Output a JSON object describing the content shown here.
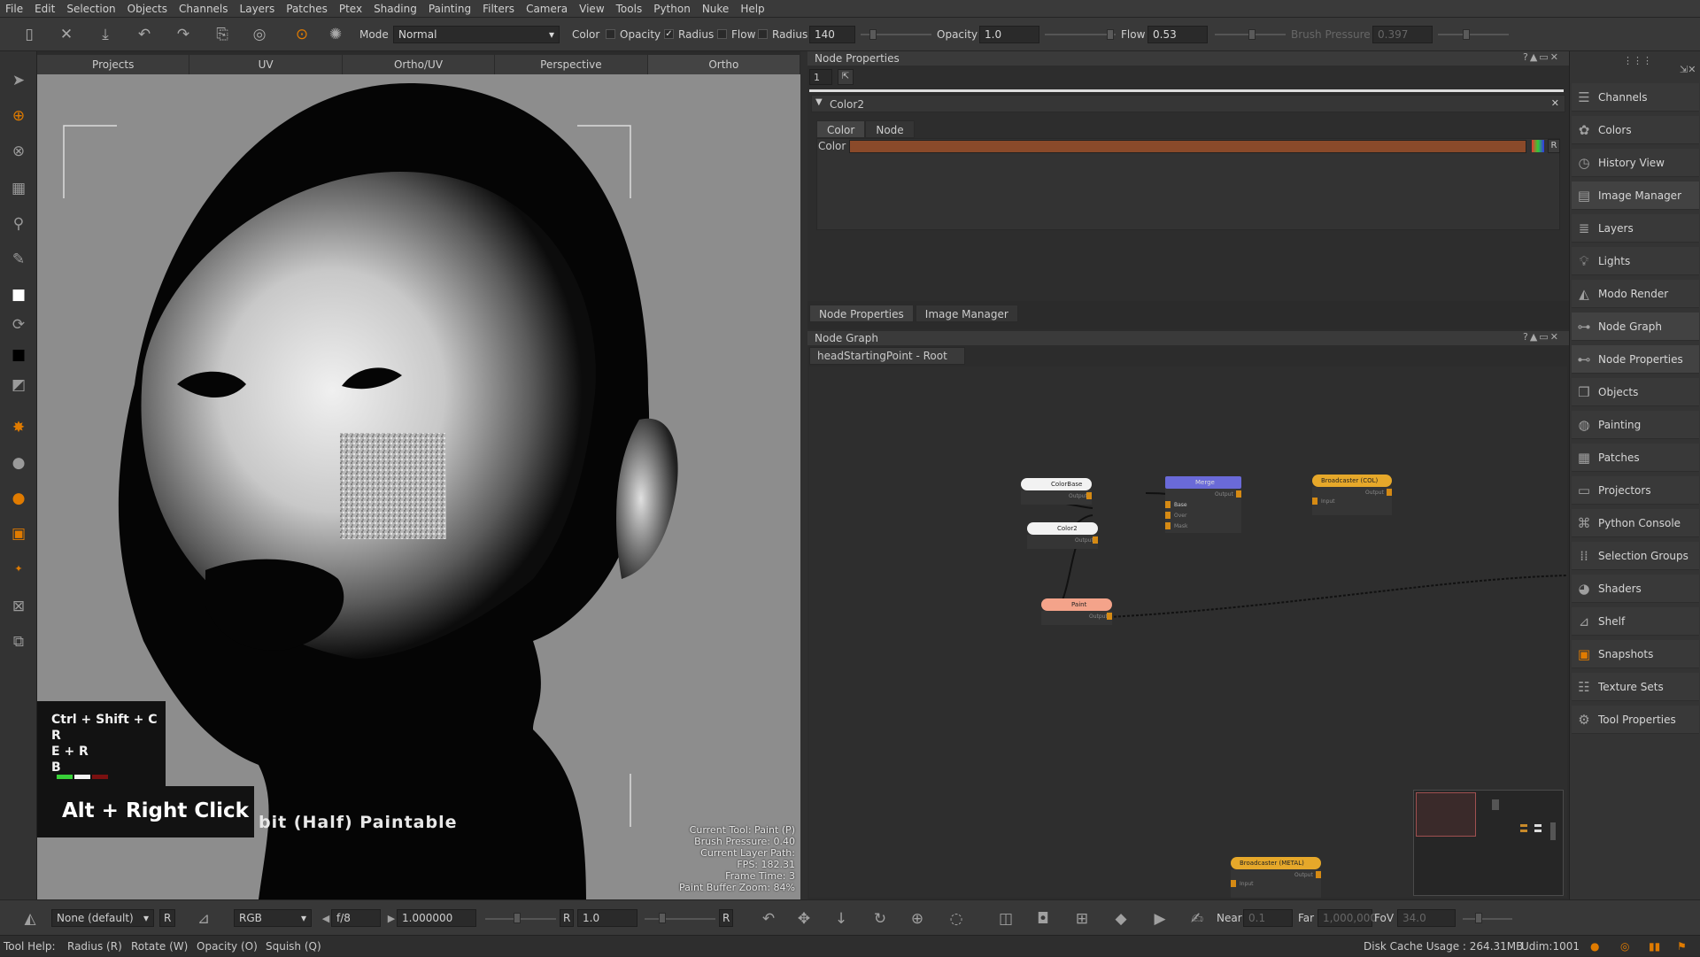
{
  "menu": [
    "File",
    "Edit",
    "Selection",
    "Objects",
    "Channels",
    "Layers",
    "Patches",
    "Ptex",
    "Shading",
    "Painting",
    "Filters",
    "Camera",
    "View",
    "Tools",
    "Python",
    "Nuke",
    "Help"
  ],
  "toolbar": {
    "mode_label": "Mode",
    "mode_value": "Normal",
    "color_label": "Color",
    "opacity_check_label": "Opacity",
    "radius_check_label": "Radius",
    "flow_check_label": "Flow",
    "radius_label": "Radius",
    "radius_value": "140",
    "opacity_label": "Opacity",
    "opacity_value": "1.0",
    "flow_label": "Flow",
    "flow_value": "0.53",
    "brush_pressure_label": "Brush Pressure",
    "brush_pressure_value": "0.397"
  },
  "view_tabs": [
    "Projects",
    "UV",
    "Ortho/UV",
    "Perspective",
    "Ortho"
  ],
  "viewport": {
    "hotkeys": [
      "Ctrl + Shift + C",
      "R",
      "E + R",
      "B"
    ],
    "alt_click": "Alt + Right Click",
    "paint_text": "bit (Half) Paintable",
    "info": [
      "Current Tool: Paint (P)",
      "Brush Pressure: 0.40",
      "Current Layer Path:",
      "FPS: 182.31",
      "Frame Time: 3",
      "Paint Buffer Zoom: 84%"
    ]
  },
  "node_properties": {
    "title": "Node Properties",
    "count": "1",
    "node_name": "Color2",
    "tabs": [
      "Color",
      "Node"
    ],
    "color_label": "Color",
    "color_value": "#8a4a2a",
    "reset_label": "R"
  },
  "bottom_tabs": [
    "Node Properties",
    "Image Manager"
  ],
  "node_graph": {
    "title": "Node Graph",
    "path_tab": "headStartingPoint - Root",
    "nodes": {
      "colorbase": "ColorBase",
      "color2": "Color2",
      "paint": "Paint",
      "merge": "Merge",
      "bcast_col": "Broadcaster (COL)",
      "bcast_metal": "Broadcaster (METAL)"
    },
    "ports": {
      "output": "Output",
      "input": "Input",
      "base": "Base",
      "over": "Over",
      "mask": "Mask"
    }
  },
  "dock": [
    "Channels",
    "Colors",
    "History View",
    "Image Manager",
    "Layers",
    "Lights",
    "Modo Render",
    "Node Graph",
    "Node Properties",
    "Objects",
    "Painting",
    "Patches",
    "Projectors",
    "Python Console",
    "Selection Groups",
    "Shaders",
    "Shelf",
    "Snapshots",
    "Texture Sets",
    "Tool Properties"
  ],
  "bottombar": {
    "shader": "None (default)",
    "channel": "RGB",
    "fstop": "f/8",
    "exposure": "1.000000",
    "gamma": "1.0",
    "r_label": "R",
    "near_label": "Near",
    "near_value": "0.1",
    "far_label": "Far",
    "far_value": "1,000,000",
    "fov_label": "FoV",
    "fov_value": "34.0"
  },
  "status": {
    "tool_help": "Tool Help:",
    "hints": [
      "Radius (R)",
      "Rotate (W)",
      "Opacity (O)",
      "Squish (Q)"
    ],
    "disk_cache": "Disk Cache Usage : 264.31MB",
    "udim": "Udim:1001"
  },
  "colors": {
    "accent_orange": "#e07b00",
    "merge_node": "#6a6ad8",
    "paint_node": "#f4a38a",
    "broadcaster_node": "#e6a82a"
  }
}
